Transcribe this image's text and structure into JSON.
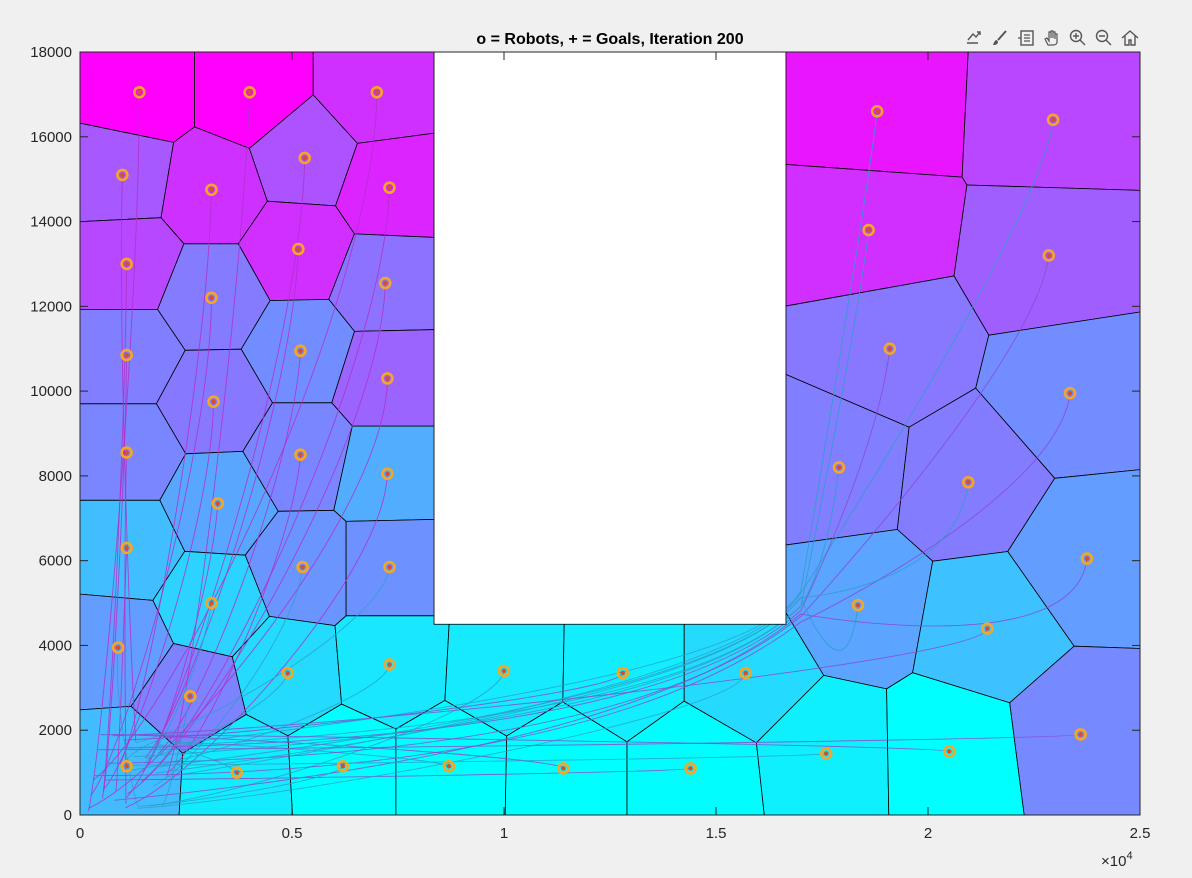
{
  "chart_data": {
    "type": "scatter",
    "title": "o = Robots, + = Goals, Iteration 200",
    "xlabel": "",
    "ylabel": "",
    "xlim": [
      0,
      25000
    ],
    "ylim": [
      0,
      18000
    ],
    "x_exponent_label": "×10",
    "x_exponent_power": "4",
    "x_ticks": [
      0,
      5000,
      10000,
      15000,
      20000,
      25000
    ],
    "x_tick_labels": [
      "0",
      "0.5",
      "1",
      "1.5",
      "2",
      "2.5"
    ],
    "y_ticks": [
      0,
      2000,
      4000,
      6000,
      8000,
      10000,
      12000,
      14000,
      16000,
      18000
    ],
    "y_tick_labels": [
      "0",
      "2000",
      "4000",
      "6000",
      "8000",
      "10000",
      "12000",
      "14000",
      "16000",
      "18000"
    ],
    "grid": false,
    "colors": {
      "robot_marker": "#f5a623",
      "goal_marker": "#d4502a",
      "obstacle": "#ffffff",
      "cell_edge": "#000000",
      "colormap": "cool"
    },
    "obstacle": {
      "x_range": [
        8350,
        16650
      ],
      "y_range": [
        4500,
        18000
      ]
    },
    "robots": [
      {
        "x": 1400,
        "y": 17050
      },
      {
        "x": 4000,
        "y": 17050
      },
      {
        "x": 7000,
        "y": 17050
      },
      {
        "x": 1000,
        "y": 15100
      },
      {
        "x": 3100,
        "y": 14750
      },
      {
        "x": 5300,
        "y": 15500
      },
      {
        "x": 7300,
        "y": 14800
      },
      {
        "x": 1100,
        "y": 13000
      },
      {
        "x": 5150,
        "y": 13350
      },
      {
        "x": 7200,
        "y": 12550
      },
      {
        "x": 3100,
        "y": 12200
      },
      {
        "x": 1100,
        "y": 10850
      },
      {
        "x": 5200,
        "y": 10950
      },
      {
        "x": 7250,
        "y": 10300
      },
      {
        "x": 3150,
        "y": 9750
      },
      {
        "x": 1100,
        "y": 8550
      },
      {
        "x": 5200,
        "y": 8500
      },
      {
        "x": 7250,
        "y": 8050
      },
      {
        "x": 3250,
        "y": 7350
      },
      {
        "x": 1100,
        "y": 6300
      },
      {
        "x": 5250,
        "y": 5850
      },
      {
        "x": 7300,
        "y": 5850
      },
      {
        "x": 3100,
        "y": 5000
      },
      {
        "x": 900,
        "y": 3950
      },
      {
        "x": 2600,
        "y": 2800
      },
      {
        "x": 4900,
        "y": 3350
      },
      {
        "x": 7300,
        "y": 3550
      },
      {
        "x": 1100,
        "y": 1150
      },
      {
        "x": 3700,
        "y": 1000
      },
      {
        "x": 6200,
        "y": 1150
      },
      {
        "x": 8700,
        "y": 1150
      },
      {
        "x": 10000,
        "y": 3400
      },
      {
        "x": 11400,
        "y": 1100
      },
      {
        "x": 12800,
        "y": 3350
      },
      {
        "x": 14400,
        "y": 1100
      },
      {
        "x": 15700,
        "y": 3350
      },
      {
        "x": 18800,
        "y": 16600
      },
      {
        "x": 22950,
        "y": 16400
      },
      {
        "x": 18600,
        "y": 13800
      },
      {
        "x": 22850,
        "y": 13200
      },
      {
        "x": 19100,
        "y": 11000
      },
      {
        "x": 23350,
        "y": 9950
      },
      {
        "x": 17900,
        "y": 8200
      },
      {
        "x": 20950,
        "y": 7850
      },
      {
        "x": 23750,
        "y": 6050
      },
      {
        "x": 18350,
        "y": 4950
      },
      {
        "x": 21400,
        "y": 4400
      },
      {
        "x": 17600,
        "y": 1450
      },
      {
        "x": 20500,
        "y": 1500
      },
      {
        "x": 23600,
        "y": 1900
      }
    ]
  },
  "toolbar": {
    "icons": [
      "export-icon",
      "brush-icon",
      "datatip-icon",
      "pan-icon",
      "zoom-in-icon",
      "zoom-out-icon",
      "home-icon"
    ]
  }
}
